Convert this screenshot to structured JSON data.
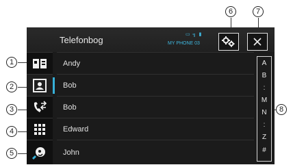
{
  "header": {
    "title": "Telefonbog",
    "status_icons": "▭ ╗ ▮",
    "phone_name": "MY PHONE 03"
  },
  "buttons": {
    "settings": "settings-icon",
    "close": "close-icon"
  },
  "sidebar": [
    {
      "icon": "phonebook-icon",
      "active": false
    },
    {
      "icon": "contact-card-icon",
      "active": true
    },
    {
      "icon": "call-history-icon",
      "active": false
    },
    {
      "icon": "keypad-icon",
      "active": false
    },
    {
      "icon": "voice-recognition-icon",
      "active": false
    }
  ],
  "contacts": [
    "Andy",
    "Bob",
    "Bob",
    "Edward",
    "John"
  ],
  "index_bar": [
    "A",
    "B",
    ":",
    "M",
    "N",
    ":",
    "Z",
    "#"
  ],
  "callouts": [
    "1",
    "2",
    "3",
    "4",
    "5",
    "6",
    "7",
    "8"
  ],
  "colors": {
    "accent": "#36b0d8",
    "status_text": "#3fb8e0",
    "background": "#1b1b1b"
  }
}
